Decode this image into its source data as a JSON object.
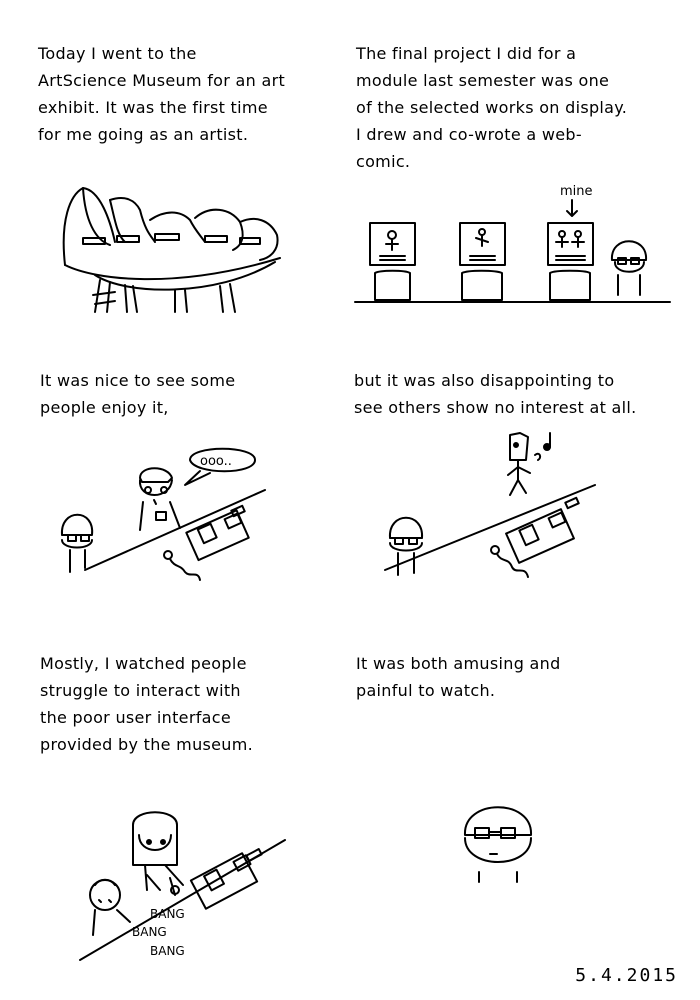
{
  "panels": [
    {
      "caption": "Today I went to the\nArtScience Museum for an art\nexhibit. It was the first time\nfor me going as an artist."
    },
    {
      "caption": "The final project I did for a\nmodule last semester was one\nof the selected works on display.\nI drew and co-wrote a web-\ncomic.",
      "label": "mine"
    },
    {
      "caption": "It was nice to see some\npeople enjoy it,",
      "speech": "ooo.."
    },
    {
      "caption": "but it was also disappointing to\nsee others show no interest at all."
    },
    {
      "caption": "Mostly, I watched people\nstruggle to interact with\nthe poor user interface\nprovided by the museum.",
      "sfx": [
        "BANG",
        "BANG",
        "BANG"
      ]
    },
    {
      "caption": "It was both amusing and\npainful to watch."
    }
  ],
  "date": "5.4.2015"
}
